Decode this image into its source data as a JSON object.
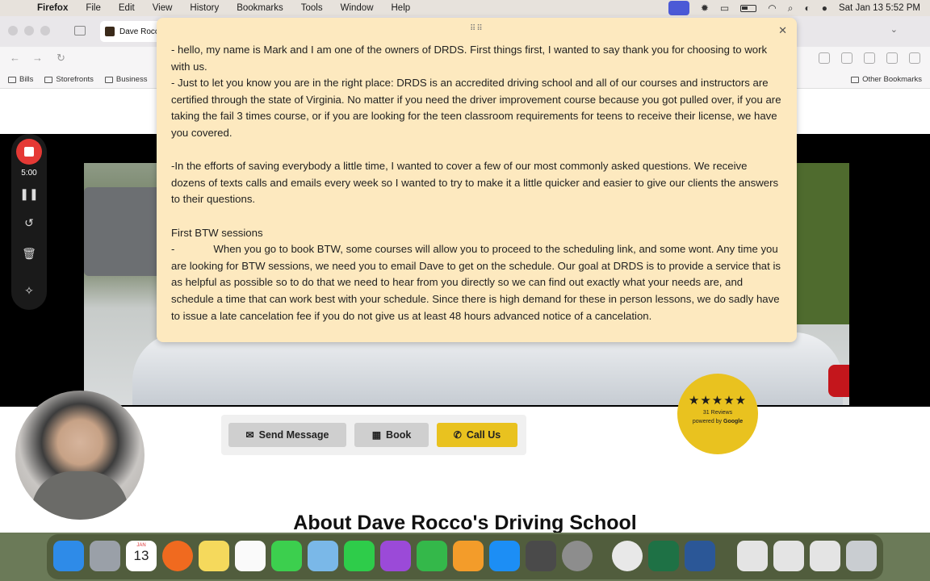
{
  "menubar": {
    "app": "Firefox",
    "items": [
      "File",
      "Edit",
      "View",
      "History",
      "Bookmarks",
      "Tools",
      "Window",
      "Help"
    ],
    "clock": "Sat Jan 13  5:52 PM"
  },
  "browser": {
    "tab_title": "Dave Rocco",
    "bookmarks": [
      "Bills",
      "Storefronts",
      "Business"
    ],
    "other_bookmarks": "Other Bookmarks"
  },
  "panel": {
    "paragraphs": [
      "- hello, my name is Mark and I am one of the owners of DRDS. First things first, I wanted to say thank you for choosing to work with us.",
      "- Just to let you know you are in the right place: DRDS is an accredited driving school and all of our courses and instructors are certified through the state of Virginia. No matter if you need the driver improvement course because you got pulled over, if you are taking the fail 3 times course, or if you are looking for the teen classroom requirements for teens to receive their license, we have you covered.",
      "-In the efforts of saving everybody a little time, I wanted to cover a few of our most commonly asked questions. We receive dozens of texts calls and emails every week so I wanted to try to make it a little quicker and easier to give our clients the answers to their questions.",
      "First BTW sessions",
      "When you go to book BTW, some courses will allow you to proceed to the scheduling link, and some wont. Any time you are looking for BTW sessions, we need you to email Dave to get on the schedule. Our goal at DRDS is to provide a service that is as helpful as possible so to do that we need to hear from you directly so we can find out exactly what your needs are, and schedule a time that can work best with your schedule. Since there is high demand for these in person lessons, we do sadly have to issue a late cancelation fee if you do not give us at least 48 hours advanced notice of a cancelation."
    ],
    "dash": "-"
  },
  "actions": {
    "send_message": "Send Message",
    "book": "Book",
    "call_us": "Call Us"
  },
  "reviews": {
    "stars": "★★★★★",
    "count": "31 Reviews",
    "powered_prefix": "powered by",
    "powered_brand": "Google"
  },
  "about_heading": "About Dave Rocco's Driving School",
  "recorder": {
    "time": "5:00"
  },
  "dock": {
    "calendar_month": "JAN",
    "calendar_day": "13"
  },
  "colors": {
    "panel_bg": "#fde9bf",
    "accent_yellow": "#e9c21f",
    "record_red": "#e53935"
  }
}
